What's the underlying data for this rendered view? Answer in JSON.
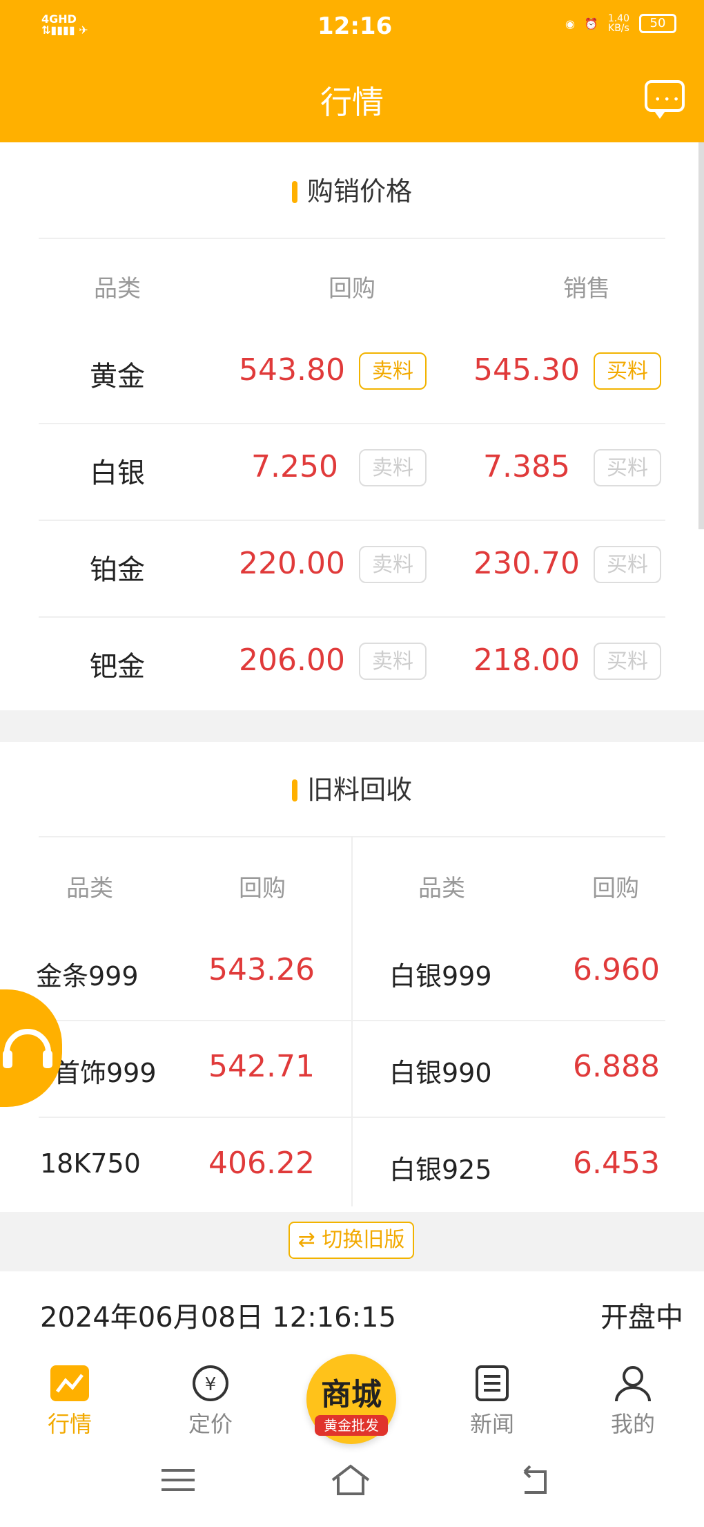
{
  "status_bar": {
    "network": "4GHD",
    "time": "12:16",
    "speed_value": "1.40",
    "speed_unit": "KB/s",
    "battery": "50"
  },
  "header": {
    "title": "行情"
  },
  "purchase_sales": {
    "title": "购销价格",
    "headers": [
      "品类",
      "回购",
      "销售"
    ],
    "buy_tag": "卖料",
    "sell_tag": "买料",
    "rows": [
      {
        "name": "黄金",
        "buyback": "543.80",
        "sale": "545.30",
        "active": true
      },
      {
        "name": "白银",
        "buyback": "7.250",
        "sale": "7.385",
        "active": false
      },
      {
        "name": "铂金",
        "buyback": "220.00",
        "sale": "230.70",
        "active": false
      },
      {
        "name": "钯金",
        "buyback": "206.00",
        "sale": "218.00",
        "active": false
      }
    ]
  },
  "recycle": {
    "title": "旧料回收",
    "headers": [
      "品类",
      "回购",
      "品类",
      "回购"
    ],
    "left": [
      {
        "name": "金条999",
        "price": "543.26"
      },
      {
        "name": "金首饰999",
        "price": "542.71"
      },
      {
        "name": "18K750",
        "price": "406.22"
      }
    ],
    "right": [
      {
        "name": "白银999",
        "price": "6.960"
      },
      {
        "name": "白银990",
        "price": "6.888"
      },
      {
        "name": "白银925",
        "price": "6.453"
      }
    ]
  },
  "switch_label": "⇄ 切换旧版",
  "footer_info": {
    "datetime": "2024年06月08日 12:16:15",
    "status": "开盘中"
  },
  "bottom_nav": {
    "items": [
      "行情",
      "定价",
      "新闻",
      "我的"
    ],
    "mall_main": "商城",
    "mall_sub": "黄金批发"
  },
  "colors": {
    "accent": "#FFB000",
    "price": "#e03a3a"
  }
}
